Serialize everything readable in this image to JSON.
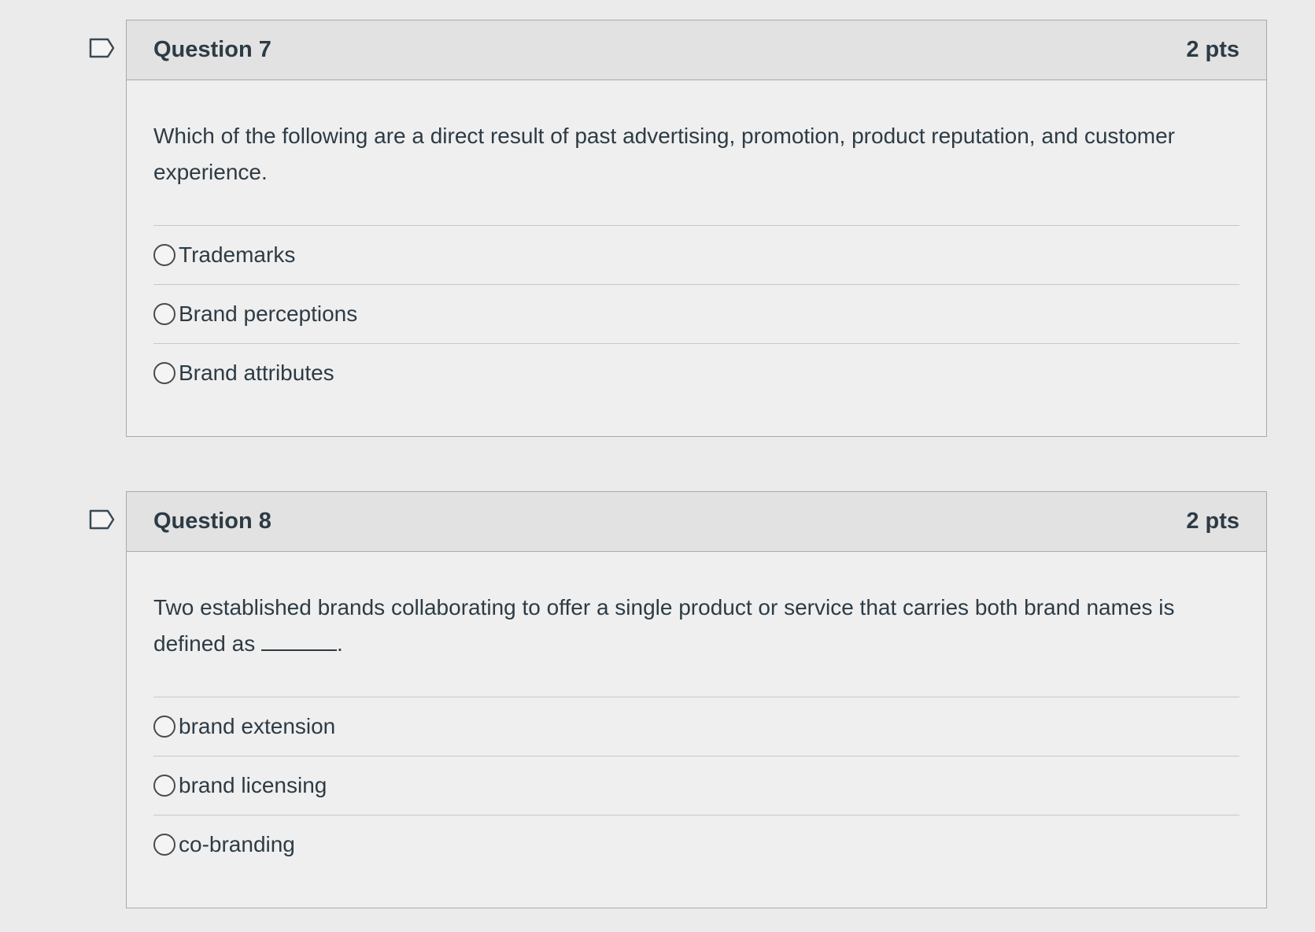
{
  "questions": [
    {
      "title": "Question 7",
      "points": "2 pts",
      "text": "Which of the following are a direct result of past advertising, promotion, product reputation, and customer experience.",
      "answers": [
        "Trademarks",
        "Brand perceptions",
        "Brand attributes"
      ]
    },
    {
      "title": "Question 8",
      "points": "2 pts",
      "text_before": "Two established brands collaborating to offer a single product or service that carries both brand names is defined as ",
      "text_after": ".",
      "answers": [
        "brand extension",
        "brand licensing",
        "co-branding"
      ]
    }
  ],
  "colors": {
    "page_background": "#ebebeb",
    "header_background": "#e2e2e2",
    "body_background": "#efefef",
    "border": "#a9a9a9",
    "text": "#2d3b45"
  },
  "icons": {
    "flag": "flag-question-icon",
    "radio": "radio-unselected-icon"
  }
}
